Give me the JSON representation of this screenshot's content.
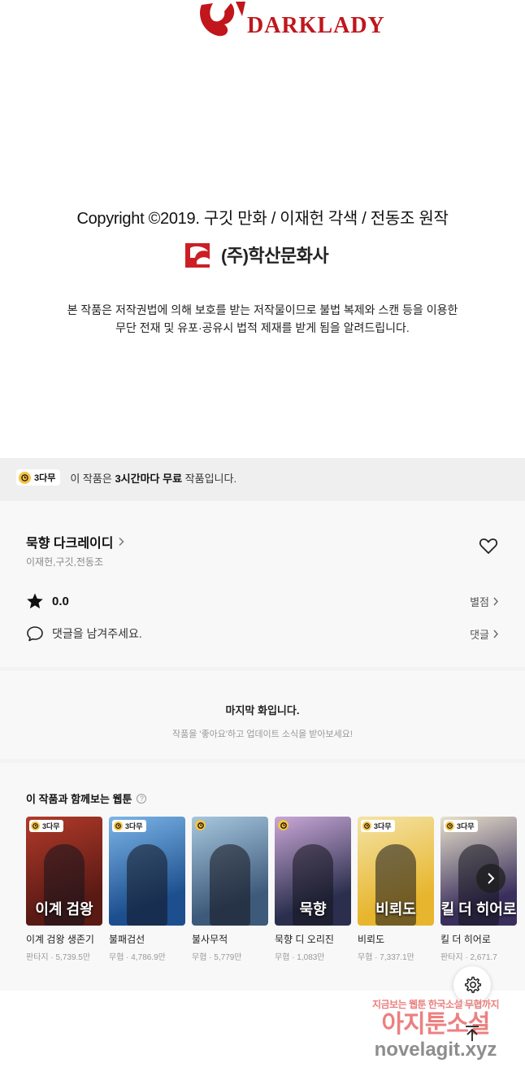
{
  "artwork": {
    "logo_text": "DARKLADY",
    "copyright": "Copyright ©2019. 구깃 만화 / 이재헌 각색 / 전동조 원작",
    "publisher": "(주)학산문화사",
    "publisher_mark_text": "HAKSAN",
    "notice_line1": "본 작품은 저작권법에 의해 보호를 받는 저작물이므로 불법 복제와 스캔 등을 이용한",
    "notice_line2": "무단 전재 및 유포·공유시 법적 제재를 받게 됨을 알려드립니다."
  },
  "free_banner": {
    "badge": "3다무",
    "text_prefix": "이 작품은 ",
    "text_bold": "3시간마다 무료",
    "text_suffix": " 작품입니다."
  },
  "series": {
    "title": "묵향 다크레이디",
    "authors": "이재헌,구깃,전동조",
    "rating": "0.0",
    "rating_link": "별점",
    "comment_prompt": "댓글을 남겨주세요.",
    "comment_link": "댓글"
  },
  "last_episode": {
    "title": "마지막 화입니다.",
    "subtitle": "작품을 '좋아요'하고 업데이트 소식을 받아보세요!"
  },
  "recommendations": {
    "title": "이 작품과 함께보는 웹툰",
    "help": "?",
    "items": [
      {
        "title": "이계 검왕 생존기",
        "meta": "판타지 · 5,739.5만",
        "badge": "3다무",
        "cover_text": "이계 검왕",
        "color_a": "#5a1a14",
        "color_b": "#b23a2a"
      },
      {
        "title": "불패검선",
        "meta": "무협 · 4,786.9만",
        "badge": "3다무",
        "cover_text": "",
        "color_a": "#1d4f8f",
        "color_b": "#7cb6e8"
      },
      {
        "title": "불사무적",
        "meta": "무협 · 5,779만",
        "badge": "",
        "cover_text": "",
        "color_a": "#3d5a7a",
        "color_b": "#a7c7df"
      },
      {
        "title": "묵향 디 오리진",
        "meta": "무협 · 1,083만",
        "badge": "",
        "cover_text": "묵향",
        "color_a": "#2b2f4d",
        "color_b": "#c9a7d7"
      },
      {
        "title": "비뢰도",
        "meta": "무협 · 7,337.1만",
        "badge": "3다무",
        "cover_text": "비뢰도",
        "color_a": "#e7b62e",
        "color_b": "#f4e3a6"
      },
      {
        "title": "킬 더 히어로",
        "meta": "판타지 · 2,671.7",
        "badge": "3다무",
        "cover_text": "킬 더 히어로",
        "color_a": "#3a2f5c",
        "color_b": "#e8e1cc"
      }
    ]
  },
  "watermark": {
    "line1": "지금보는 웹툰 한국소설 무협까지",
    "line2": "아지툰소설",
    "line3": "novelagit.xyz"
  },
  "colors": {
    "accent_clock": "#f6c343",
    "brand_red": "#cc1f25",
    "background": "#f8f8f8"
  }
}
